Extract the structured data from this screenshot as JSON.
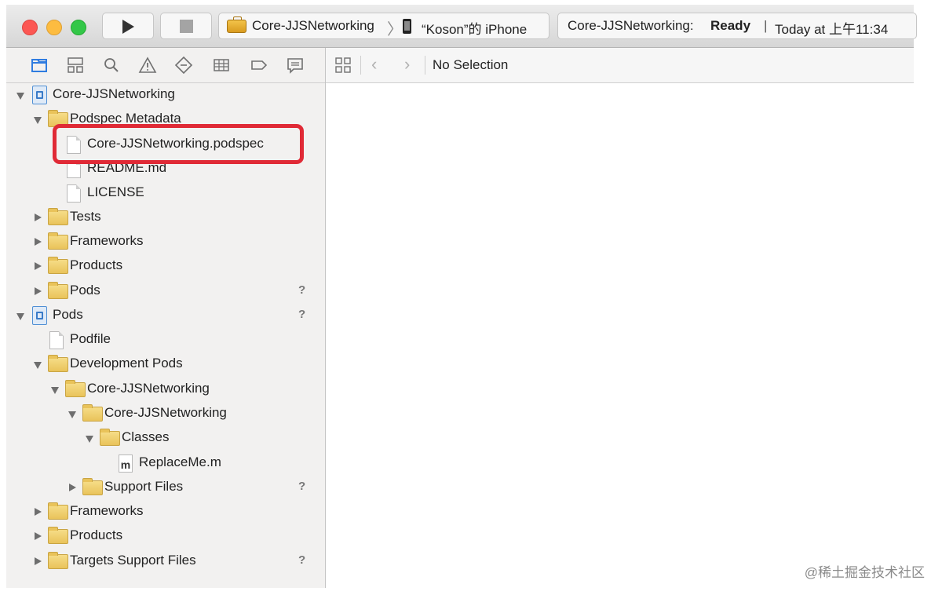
{
  "toolbar": {
    "scheme_name": "Core-JJSNetworking",
    "scheme_separator": "〉",
    "device_name": "“Koson”的 iPhone",
    "status_project": "Core-JJSNetworking:",
    "status_ready": "Ready",
    "status_separator": "|",
    "status_time": "Today at 上午11:34"
  },
  "navigator_tabs": [
    "project-navigator-icon",
    "symbol-navigator-icon",
    "find-navigator-icon",
    "issue-navigator-icon",
    "test-navigator-icon",
    "debug-navigator-icon",
    "breakpoint-navigator-icon",
    "report-navigator-icon"
  ],
  "tree": {
    "core_project": "Core-JJSNetworking",
    "podspec_metadata": "Podspec Metadata",
    "podspec_file": "Core-JJSNetworking.podspec",
    "readme": "README.md",
    "license": "LICENSE",
    "tests": "Tests",
    "frameworks": "Frameworks",
    "products": "Products",
    "pods_group": "Pods",
    "pods_project": "Pods",
    "podfile": "Podfile",
    "development_pods": "Development Pods",
    "core_group": "Core-JJSNetworking",
    "core_subgroup": "Core-JJSNetworking",
    "classes": "Classes",
    "replaceme": "ReplaceMe.m",
    "replaceme_badge": "m",
    "support_files": "Support Files",
    "frameworks2": "Frameworks",
    "products2": "Products",
    "targets_support_files": "Targets Support Files",
    "unknown_badge": "?"
  },
  "editor": {
    "no_selection": "No Selection"
  },
  "watermark": "@稀土掘金技术社区",
  "colors": {
    "highlight_border": "#e02a36",
    "close": "#fc5753",
    "minimize": "#fdbc40",
    "zoom": "#33c748"
  }
}
